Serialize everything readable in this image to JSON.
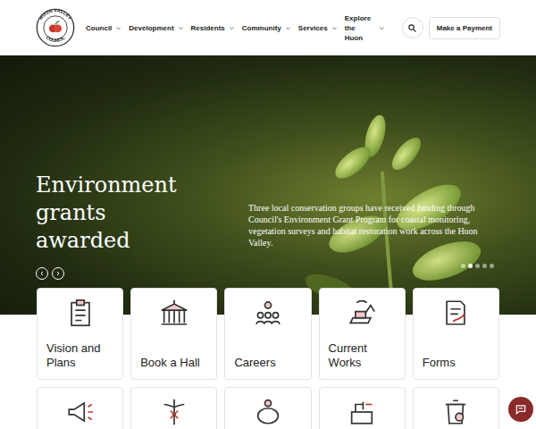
{
  "header": {
    "logo": {
      "top": "HUON VALLEY",
      "bottom": "COUNCIL"
    },
    "nav": [
      {
        "label": "Council"
      },
      {
        "label": "Development"
      },
      {
        "label": "Residents"
      },
      {
        "label": "Community"
      },
      {
        "label": "Services"
      },
      {
        "label": "Explore the Huon"
      }
    ],
    "button": "Make a Payment"
  },
  "hero": {
    "title": "Environment grants awarded",
    "text": "Three local conservation groups have received funding through Council's Environment Grant Program for coastal monitoring, vegetation surveys and habitat restoration work across the Huon Valley.",
    "slides": [
      {
        "selected": false
      },
      {
        "selected": true
      },
      {
        "selected": false
      },
      {
        "selected": false
      },
      {
        "selected": false
      }
    ]
  },
  "cards": [
    {
      "label": "Vision and Plans"
    },
    {
      "label": "Book a Hall"
    },
    {
      "label": "Careers"
    },
    {
      "label": "Current Works"
    },
    {
      "label": "Forms"
    }
  ]
}
